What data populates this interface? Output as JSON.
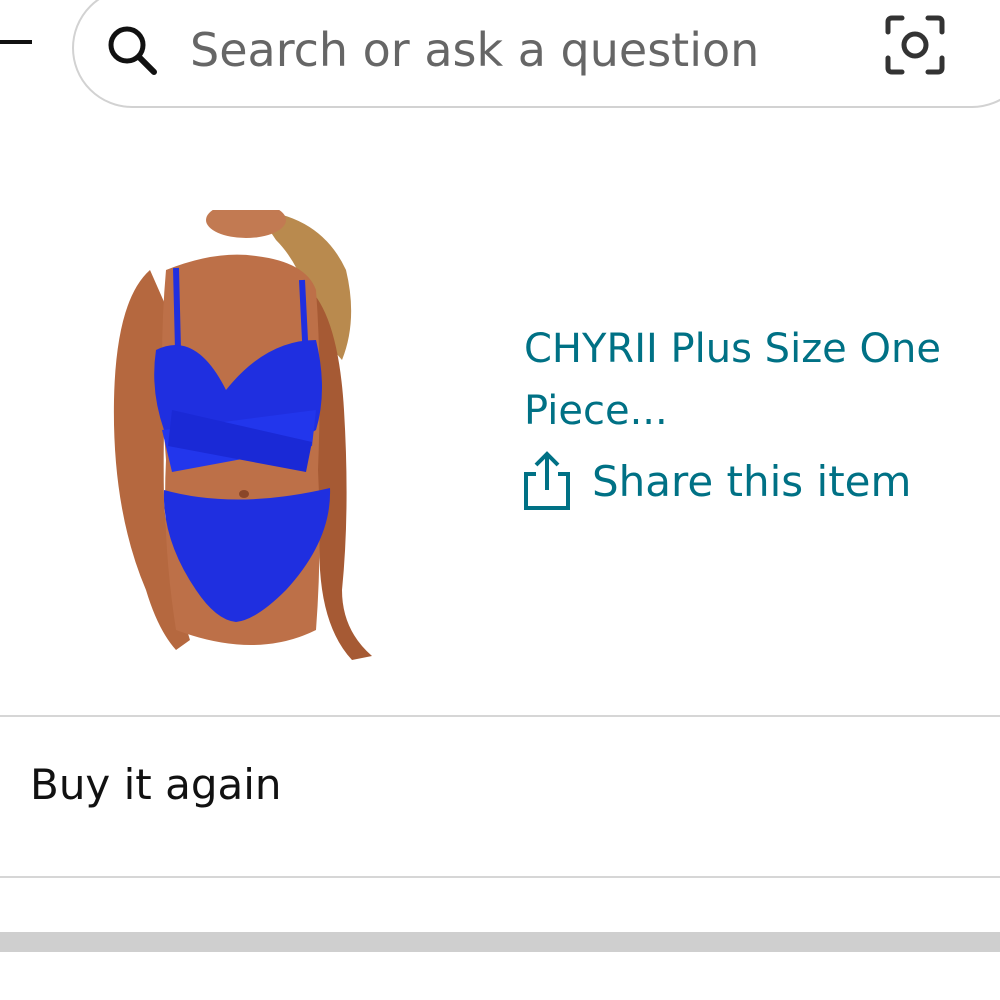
{
  "search": {
    "placeholder": "Search or ask a question"
  },
  "product": {
    "title": "CHYRII Plus Size One Piece...",
    "share_label": "Share this item",
    "image_alt": "Blue criss-cross cutout one-piece swimsuit",
    "swimsuit_color": "#1f2fe0"
  },
  "sections": {
    "buy_again_label": "Buy it again"
  },
  "colors": {
    "link": "#007185",
    "divider": "#d6d6d6"
  },
  "icons": {
    "back": "minus-icon",
    "search": "search-icon",
    "camera": "camera-scan-icon",
    "share": "share-icon"
  }
}
